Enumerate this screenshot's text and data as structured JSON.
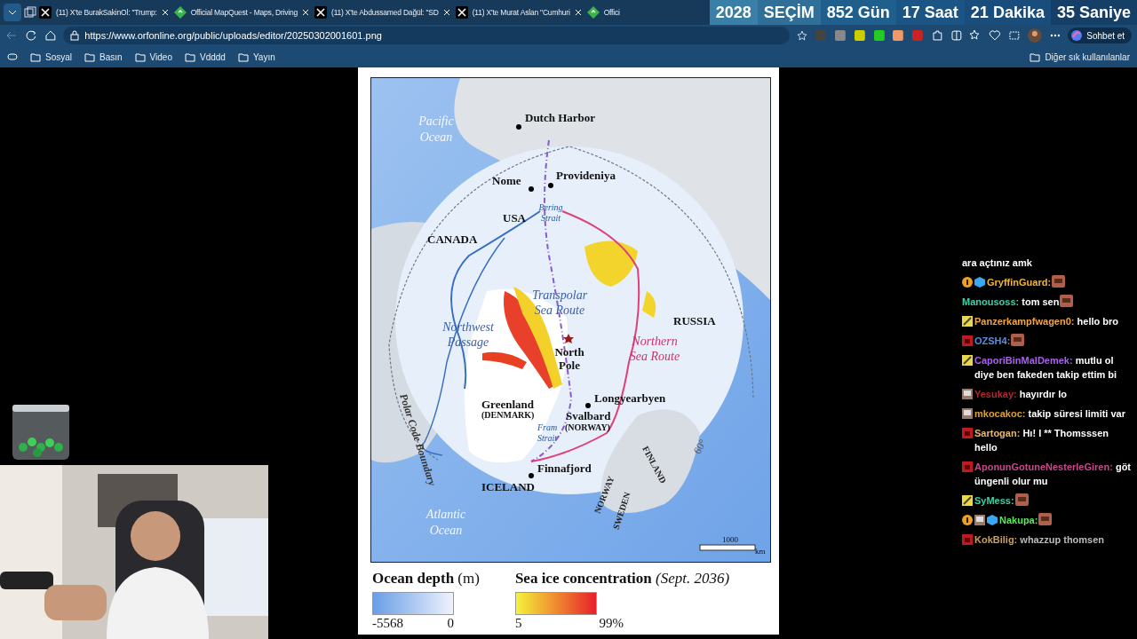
{
  "browser": {
    "tabs": [
      {
        "title": "(11) X'te BurakSakinOl: \"Trump:",
        "selected": false
      },
      {
        "title": "Official MapQuest - Maps, Driving",
        "selected": false
      },
      {
        "title": "(11) X'te Abdussamed Dağül: \"SD",
        "selected": false
      },
      {
        "title": "(11) X'te Murat Aslan \"Cumhuri",
        "selected": false
      },
      {
        "title": "Offici",
        "selected": false
      }
    ],
    "address": "https://www.orfonline.org/public/uploads/editor/20250302001601.png",
    "copilot_button": "Sohbet et",
    "bookmarks": [
      "Sosyal",
      "Basın",
      "Video",
      "Vdddd",
      "Yayın"
    ],
    "other_bookmarks": "Diğer sık kullanılanlar"
  },
  "countdown": [
    "2028",
    "SEÇİM",
    "852 Gün",
    "17 Saat",
    "21 Dakika",
    "35 Saniye"
  ],
  "map": {
    "labels": [
      {
        "text": "Pacific Ocean",
        "kind": "ocean"
      },
      {
        "text": "Dutch Harbor",
        "kind": "place"
      },
      {
        "text": "Nome",
        "kind": "place"
      },
      {
        "text": "Provideniya",
        "kind": "place"
      },
      {
        "text": "USA",
        "kind": "place"
      },
      {
        "text": "Bering Strait",
        "kind": "strait"
      },
      {
        "text": "CANADA",
        "kind": "place"
      },
      {
        "text": "Transpolar Sea Route",
        "kind": "route"
      },
      {
        "text": "Northwest Passage",
        "kind": "route"
      },
      {
        "text": "RUSSIA",
        "kind": "place"
      },
      {
        "text": "North Pole",
        "kind": "place"
      },
      {
        "text": "Northern Sea Route",
        "kind": "route-pink"
      },
      {
        "text": "Polar Code Boundary",
        "kind": "boundary"
      },
      {
        "text": "Greenland",
        "kind": "place"
      },
      {
        "text": "(DENMARK)",
        "kind": "small"
      },
      {
        "text": "Longyearbyen",
        "kind": "place"
      },
      {
        "text": "Svalbard",
        "kind": "place"
      },
      {
        "text": "(NORWAY)",
        "kind": "small"
      },
      {
        "text": "Fram Strait",
        "kind": "strait"
      },
      {
        "text": "Finnafjord",
        "kind": "place"
      },
      {
        "text": "ICELAND",
        "kind": "place"
      },
      {
        "text": "NORWAY",
        "kind": "tilted"
      },
      {
        "text": "SWEDEN",
        "kind": "tilted"
      },
      {
        "text": "FINLAND",
        "kind": "tilted"
      },
      {
        "text": "60°",
        "kind": "grey"
      },
      {
        "text": "Atlantic Ocean",
        "kind": "ocean"
      },
      {
        "text": "1000",
        "kind": "scale"
      },
      {
        "text": "km",
        "kind": "scale"
      }
    ],
    "legend": [
      {
        "title": "**Ocean depth** (m)",
        "kind": "depth",
        "min": "-5568",
        "max": "0"
      },
      {
        "title": "**Sea ice concentration** *(Sept. 2036)*",
        "kind": "ice",
        "min": "5",
        "max": "99%"
      }
    ]
  },
  "chat": {
    "messages": [
      {
        "text": "ara açtınız amk",
        "emote": false
      },
      {
        "user": "GryffinGuard:",
        "color": "#f0b53c",
        "emote": true
      },
      {
        "user": "Manousoss:",
        "color": "#3fcfa8",
        "text": "tom sen",
        "emote": true
      },
      {
        "user": "Panzerkampfwagen0:",
        "color": "#f0a64a",
        "text": "hello bro",
        "emote": false
      },
      {
        "user": "OZSH4:",
        "color": "#5b8de0",
        "emote": true
      },
      {
        "user": "CaporiBinMalDemek:",
        "color": "#a862ee",
        "text": "mutlu ol diye ben fakeden takip ettim bi",
        "emote": false
      },
      {
        "user": "Yesukay:",
        "color": "#b5262e",
        "text": "hayırdır lo",
        "emote": false
      },
      {
        "user": "mkocakoc:",
        "color": "#e0a030",
        "text": "takip süresi limiti var",
        "emote": false
      },
      {
        "user": "Sartogan:",
        "color": "#e8b870",
        "text": "Hı! I ** Thomsssen hello",
        "emote": false
      },
      {
        "user": "AponunGotuneNesterleGiren:",
        "color": "#c84a8a",
        "text": "göt üngenli olur mu",
        "emote": false
      },
      {
        "user": "SyMess:",
        "color": "#3fcfa8",
        "emote": true
      },
      {
        "user": "Nakupa:",
        "color": "#5ee85e",
        "emote": true
      },
      {
        "user": "KokBilig:",
        "color": "#c8a060",
        "text": "whazzup thomsen",
        "emote": false
      }
    ]
  }
}
